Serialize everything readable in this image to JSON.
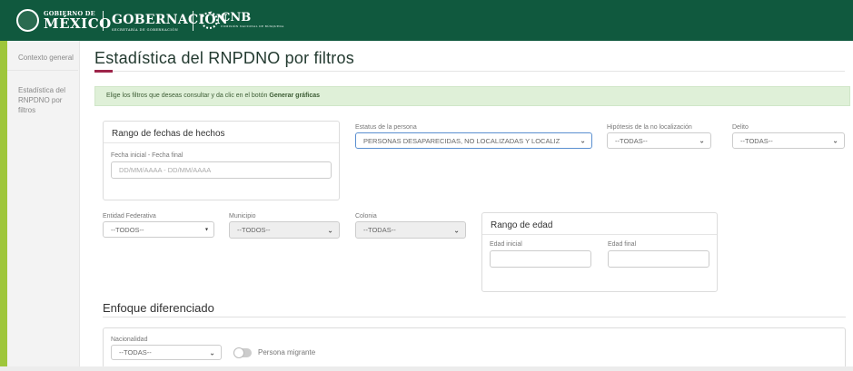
{
  "header": {
    "gob_small": "GOBIERNO DE",
    "gob_big": "MÉXICO",
    "gobernacion": "GOBERNACIÓN",
    "gobernacion_sub": "SECRETARÍA DE GOBERNACIÓN",
    "cnb": "CNB",
    "cnb_sub": "COMISIÓN NACIONAL DE BÚSQUEDA",
    "bar_color": "#10593e"
  },
  "sidebar": {
    "items": [
      {
        "label": "Contexto general"
      },
      {
        "label": "Estadística del RNPDNO por filtros"
      }
    ]
  },
  "main": {
    "title": "Estadística del RNPDNO por filtros",
    "alert_text": "Elige los filtros que deseas consultar y da clic en el botón ",
    "alert_bold": "Generar gráficas",
    "fecha_panel": {
      "title": "Rango de fechas de hechos",
      "label": "Fecha inicial  -  Fecha final",
      "placeholder": "DD/MM/AAAA - DD/MM/AAAA"
    },
    "estatus": {
      "label": "Estatus de la persona",
      "value": "PERSONAS DESAPARECIDAS, NO LOCALIZADAS Y LOCALIZ"
    },
    "hipotesis": {
      "label": "Hipótesis de la no localización",
      "value": "--TODAS--"
    },
    "delito": {
      "label": "Delito",
      "value": "--TODAS--"
    },
    "entidad": {
      "label": "Entidad Federativa",
      "value": "--TODOS--"
    },
    "municipio": {
      "label": "Municipio",
      "value": "--TODOS--"
    },
    "colonia": {
      "label": "Colonia",
      "value": "--TODAS--"
    },
    "edad_panel": {
      "title": "Rango de edad",
      "inicial": "Edad inicial",
      "final": "Edad final"
    },
    "enfoque": {
      "title": "Enfoque diferenciado",
      "nacionalidad_label": "Nacionalidad",
      "nacionalidad_value": "--TODAS--",
      "migrante_label": "Persona migrante"
    }
  }
}
